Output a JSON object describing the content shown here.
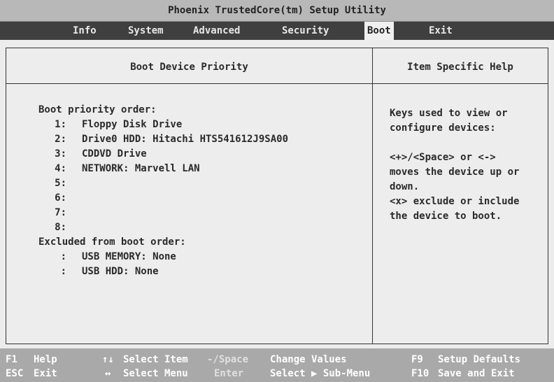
{
  "title": "Phoenix TrustedCore(tm) Setup Utility",
  "menu": {
    "info": "Info",
    "system": "System",
    "advanced": "Advanced",
    "security": "Security",
    "boot": "Boot",
    "exit": "Exit"
  },
  "left_header": "Boot Device Priority",
  "right_header": "Item Specific Help",
  "boot_priority_label": "Boot priority order:",
  "boot_order": [
    {
      "num": "1:",
      "device": "Floppy Disk Drive"
    },
    {
      "num": "2:",
      "device": "Drive0 HDD: Hitachi HTS541612J9SA00"
    },
    {
      "num": "3:",
      "device": "CDDVD Drive"
    },
    {
      "num": "4:",
      "device": "NETWORK: Marvell LAN"
    },
    {
      "num": "5:",
      "device": ""
    },
    {
      "num": "6:",
      "device": ""
    },
    {
      "num": "7:",
      "device": ""
    },
    {
      "num": "8:",
      "device": ""
    }
  ],
  "excluded_label": "Excluded from boot order:",
  "excluded": [
    {
      "num": ":",
      "device": "USB MEMORY: None"
    },
    {
      "num": ":",
      "device": "USB HDD: None"
    }
  ],
  "help_lines": [
    "Keys used to view or",
    "configure devices:",
    "",
    "<+>/<Space> or <->",
    "moves the device up or",
    "down.",
    "<x> exclude or include",
    "the device to boot."
  ],
  "status": {
    "f1_key": "F1",
    "f1_text": "Help",
    "updown_key": "↑↓",
    "updown_text": "Select Item",
    "minus_key": "-/Space",
    "minus_text": "Change Values",
    "f9_key": "F9",
    "f9_text": "Setup Defaults",
    "esc_key": "ESC",
    "esc_text": "Exit",
    "lr_key": "↔",
    "lr_text": "Select Menu",
    "enter_key": "Enter",
    "enter_text": "Select ▶ Sub-Menu",
    "f10_key": "F10",
    "f10_text": "Save and Exit"
  }
}
